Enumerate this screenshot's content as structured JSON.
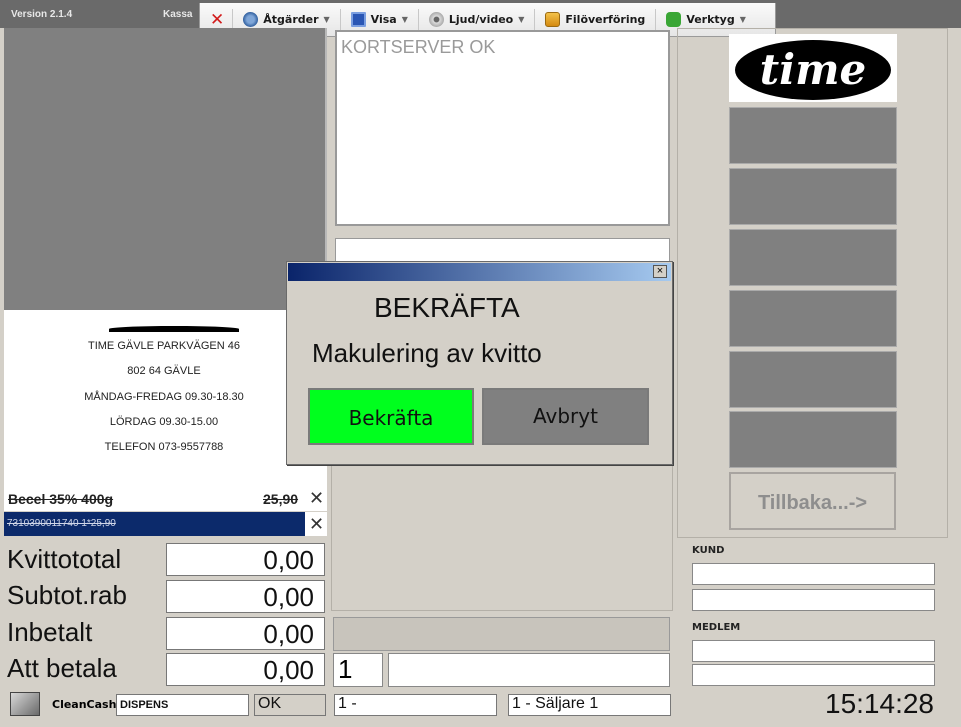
{
  "window": {
    "version": "Version 2.1.4",
    "title": "Kassa"
  },
  "toolbar": {
    "close_icon": "red-x",
    "items": [
      "Åtgärder",
      "Visa",
      "Ljud/video",
      "Filöverföring",
      "Verktyg"
    ]
  },
  "receipt": {
    "header_lines": [
      "TIME GÄVLE PARKVÄGEN 46",
      "802 64 GÄVLE",
      "MÅNDAG-FREDAG 09.30-18.30",
      "LÖRDAG  09.30-15.00",
      "TELEFON 073-9557788"
    ],
    "item": {
      "name": "Becel 35% 400g",
      "price": "25,90",
      "detail": "7310390011740  1*25,90"
    }
  },
  "totals": [
    {
      "label": "Kvittototal",
      "value": "0,00"
    },
    {
      "label": "Subtot.rab",
      "value": "0,00"
    },
    {
      "label": "Inbetalt",
      "value": "0,00"
    },
    {
      "label": "Att betala",
      "value": "0,00"
    }
  ],
  "message": "KORTSERVER OK",
  "quantity": "1",
  "right": {
    "logo_text": "time",
    "back_label": "Tillbaka...->",
    "kund_label": "KUND",
    "medlem_label": "MEDLEM"
  },
  "status": {
    "cleancash_label": "CleanCash:",
    "cleancash_value": "DISPENS",
    "ok": "OK",
    "register": "1 -",
    "seller": "1 - Säljare 1",
    "clock": "15:14:28"
  },
  "dialog": {
    "title": "BEKRÄFTA",
    "message": "Makulering av kvitto",
    "confirm": "Bekräfta",
    "cancel": "Avbryt"
  }
}
